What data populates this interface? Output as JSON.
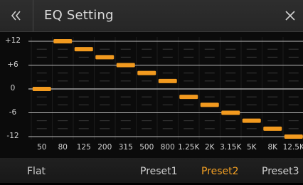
{
  "header": {
    "title": "EQ Setting"
  },
  "chart_data": {
    "type": "bar",
    "categories": [
      "50",
      "80",
      "125",
      "200",
      "315",
      "500",
      "800",
      "1.25K",
      "2K",
      "3.15K",
      "5K",
      "8K",
      "12.5K"
    ],
    "values": [
      0,
      12,
      10,
      8,
      6,
      4,
      2,
      -2,
      -4,
      -6,
      -8,
      -10,
      -12
    ],
    "yticks": [
      "+12",
      "+6",
      "0",
      "-6",
      "-12"
    ],
    "ylim": [
      -12,
      12
    ],
    "grid": true,
    "colors": {
      "handle": "#f29a1f",
      "grid": "#3a3a3a",
      "axis": "#bdbdbd"
    }
  },
  "footer": {
    "presets": [
      {
        "label": "Flat",
        "active": false
      },
      {
        "label": "Preset1",
        "active": false
      },
      {
        "label": "Preset2",
        "active": true
      },
      {
        "label": "Preset3",
        "active": false
      }
    ]
  },
  "colors": {
    "accent": "#f3a024"
  }
}
